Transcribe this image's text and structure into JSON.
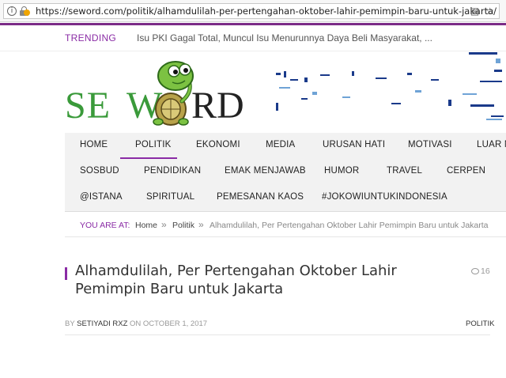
{
  "browser": {
    "url": "https://seword.com/politik/alhamdulilah-per-pertengahan-oktober-lahir-pemimpin-baru-untuk-jakarta/"
  },
  "trending": {
    "label": "TRENDING",
    "headline": "Isu PKI Gagal Total, Muncul Isu Menurunnya Daya Beli Masyarakat, ..."
  },
  "logo": {
    "part1": "SE",
    "part2": "W",
    "part3": "RD",
    "colors": {
      "green": "#3a9a3a",
      "dark": "#222222"
    }
  },
  "nav": {
    "row1": [
      "HOME",
      "POLITIK",
      "EKONOMI",
      "MEDIA",
      "URUSAN HATI",
      "MOTIVASI",
      "LUAR N"
    ],
    "row2": [
      "SOSBUD",
      "PENDIDIKAN",
      "EMAK MENJAWAB",
      "HUMOR",
      "TRAVEL",
      "CERPEN"
    ],
    "row3": [
      "@ISTANA",
      "SPIRITUAL",
      "PEMESANAN KAOS",
      "#JOKOWIUNTUKINDONESIA"
    ],
    "active": "POLITIK",
    "accent_color": "#8a2ba5"
  },
  "breadcrumb": {
    "label": "YOU ARE AT:",
    "home": "Home",
    "separator": "»",
    "section": "Politik",
    "current": "Alhamdulilah, Per Pertengahan Oktober Lahir Pemimpin Baru untuk Jakarta"
  },
  "article": {
    "title": "Alhamdulilah, Per Pertengahan Oktober Lahir Pemimpin Baru untuk Jakarta",
    "comments": "16",
    "by": "BY",
    "author": "SETIYADI RXZ",
    "on": "ON",
    "date": "OCTOBER 1, 2017",
    "category": "POLITIK"
  }
}
